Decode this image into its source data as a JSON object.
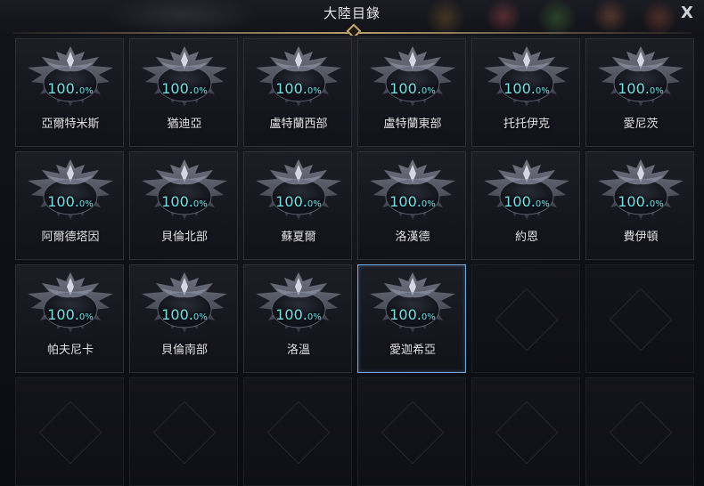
{
  "window": {
    "title": "大陸目錄",
    "close_label": "X"
  },
  "continents": [
    {
      "percent": "100.",
      "percent_suffix": "0%",
      "name": "亞爾特米斯"
    },
    {
      "percent": "100.",
      "percent_suffix": "0%",
      "name": "猶迪亞"
    },
    {
      "percent": "100.",
      "percent_suffix": "0%",
      "name": "盧特蘭西部"
    },
    {
      "percent": "100.",
      "percent_suffix": "0%",
      "name": "盧特蘭東部"
    },
    {
      "percent": "100.",
      "percent_suffix": "0%",
      "name": "托托伊克"
    },
    {
      "percent": "100.",
      "percent_suffix": "0%",
      "name": "愛尼茨"
    },
    {
      "percent": "100.",
      "percent_suffix": "0%",
      "name": "阿爾德塔因"
    },
    {
      "percent": "100.",
      "percent_suffix": "0%",
      "name": "貝倫北部"
    },
    {
      "percent": "100.",
      "percent_suffix": "0%",
      "name": "蘇夏爾"
    },
    {
      "percent": "100.",
      "percent_suffix": "0%",
      "name": "洛漢德"
    },
    {
      "percent": "100.",
      "percent_suffix": "0%",
      "name": "約恩"
    },
    {
      "percent": "100.",
      "percent_suffix": "0%",
      "name": "費伊頓"
    },
    {
      "percent": "100.",
      "percent_suffix": "0%",
      "name": "帕夫尼卡"
    },
    {
      "percent": "100.",
      "percent_suffix": "0%",
      "name": "貝倫南部"
    },
    {
      "percent": "100.",
      "percent_suffix": "0%",
      "name": "洛溫"
    },
    {
      "percent": "100.",
      "percent_suffix": "0%",
      "name": "愛迦希亞"
    }
  ],
  "selected_index": 15,
  "empty_slot_count": 8,
  "colors": {
    "percent_text": "#6fe0e6",
    "selected_border": "#7aa6d8",
    "title_accent": "#c9a86a"
  },
  "icons": {
    "emblem": "continent-emblem-icon",
    "close": "close-icon"
  }
}
